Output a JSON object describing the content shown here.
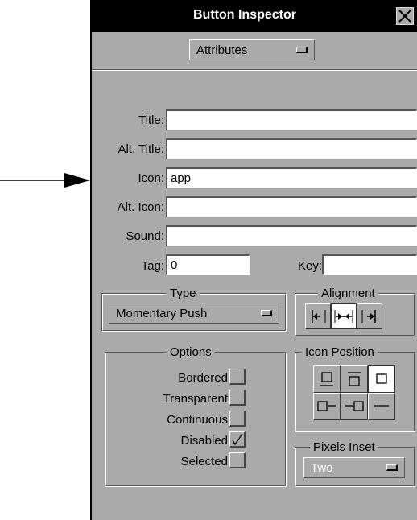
{
  "window": {
    "title": "Button Inspector"
  },
  "attributes_popup": {
    "label": "Attributes"
  },
  "fields": {
    "title": {
      "label": "Title:",
      "value": ""
    },
    "alt_title": {
      "label": "Alt. Title:",
      "value": ""
    },
    "icon": {
      "label": "Icon:",
      "value": "app"
    },
    "alt_icon": {
      "label": "Alt. Icon:",
      "value": ""
    },
    "sound": {
      "label": "Sound:",
      "value": ""
    },
    "tag": {
      "label": "Tag:",
      "value": "0"
    },
    "key": {
      "label": "Key:",
      "value": ""
    }
  },
  "type_group": {
    "title": "Type",
    "selected": "Momentary Push"
  },
  "alignment_group": {
    "title": "Alignment",
    "options": [
      "left",
      "center",
      "right"
    ],
    "selected": "center"
  },
  "options_group": {
    "title": "Options",
    "items": [
      {
        "label": "Bordered",
        "checked": false
      },
      {
        "label": "Transparent",
        "checked": false
      },
      {
        "label": "Continuous",
        "checked": false
      },
      {
        "label": "Disabled",
        "checked": true
      },
      {
        "label": "Selected",
        "checked": false
      }
    ]
  },
  "icon_position_group": {
    "title": "Icon Position",
    "options": [
      "title-only",
      "icon-above",
      "icon-only",
      "icon-left",
      "icon-right",
      "title-below"
    ],
    "selected": "icon-only"
  },
  "pixels_inset_group": {
    "title": "Pixels Inset",
    "selected": "Two",
    "enabled": false
  },
  "annotation": {
    "icon": "arrow-right-icon"
  },
  "colors": {
    "panel": "#aaaaaa",
    "titlebar": "#000000",
    "field": "#ffffff",
    "disabled_text": "#ffffff"
  }
}
